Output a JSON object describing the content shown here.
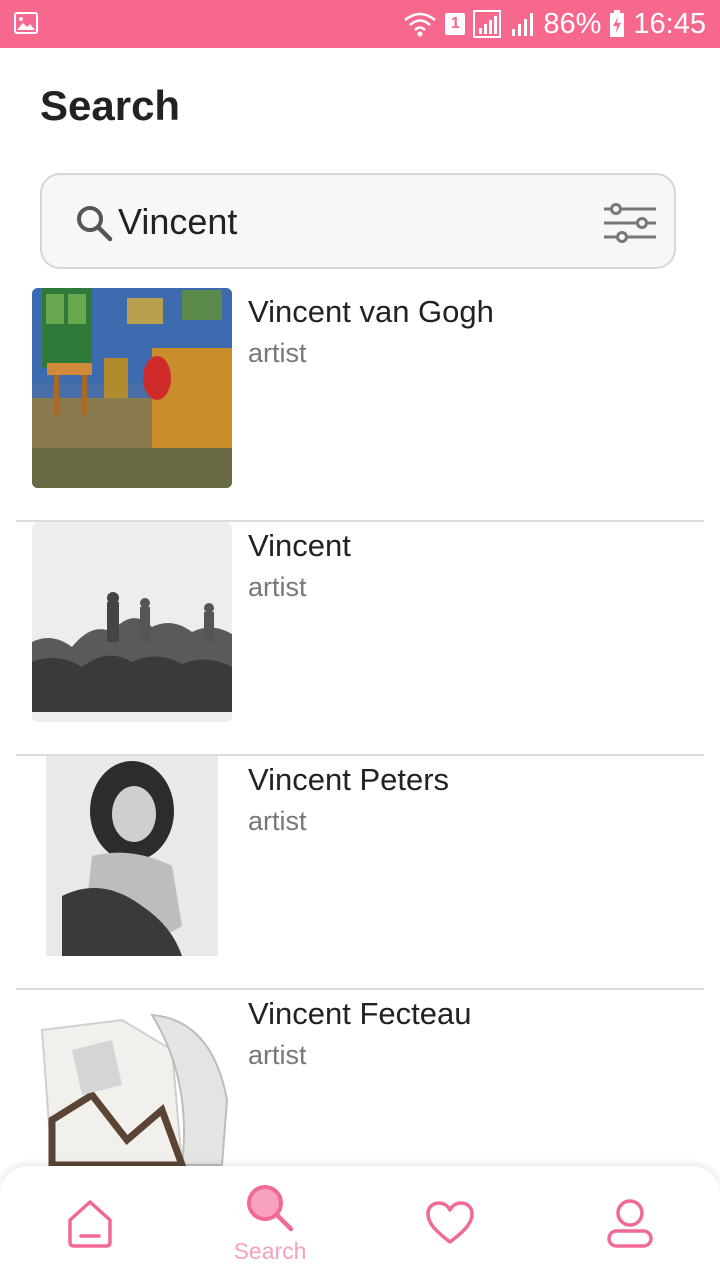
{
  "status_bar": {
    "sim_slot": "1",
    "battery_percent": "86%",
    "time": "16:45"
  },
  "header": {
    "title": "Search"
  },
  "search": {
    "value": "Vincent",
    "icon": "search-icon",
    "filter_icon": "filter-sliders-icon"
  },
  "results": [
    {
      "name": "Vincent van Gogh",
      "type": "artist"
    },
    {
      "name": "Vincent",
      "type": "artist"
    },
    {
      "name": "Vincent Peters",
      "type": "artist"
    },
    {
      "name": "Vincent Fecteau",
      "type": "artist"
    }
  ],
  "bottom_nav": {
    "items": [
      {
        "icon": "home-icon",
        "label": ""
      },
      {
        "icon": "search-icon",
        "label": "Search",
        "active": true
      },
      {
        "icon": "heart-icon",
        "label": ""
      },
      {
        "icon": "profile-icon",
        "label": ""
      }
    ]
  },
  "colors": {
    "accent": "#f7688f",
    "accent_light": "#f9a2bd",
    "text_primary": "#222222",
    "text_secondary": "#777777"
  }
}
